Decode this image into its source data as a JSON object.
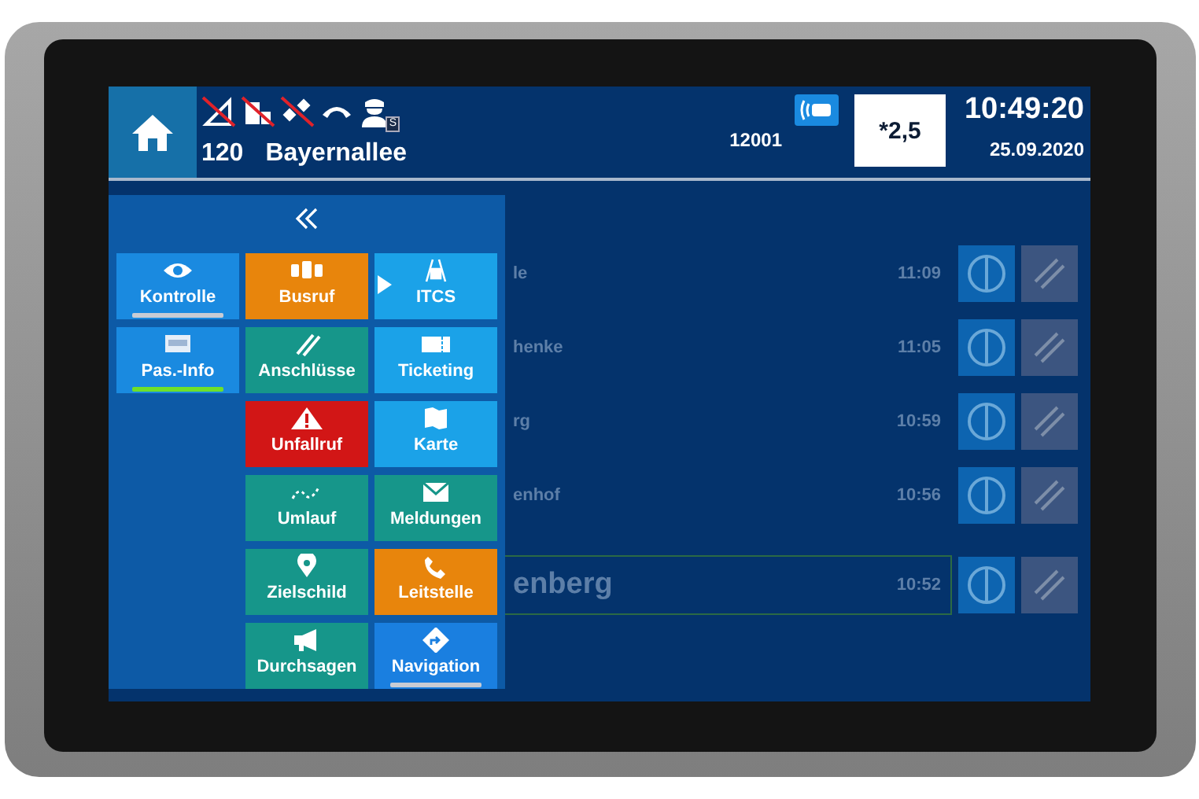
{
  "header": {
    "line": "120",
    "stop": "Bayernallee",
    "vehicle": "12001",
    "driver_badge": "S",
    "fare_zone": "*2,5",
    "time": "10:49:20",
    "date": "25.09.2020",
    "status_icons": [
      {
        "kind": "signal",
        "off": true
      },
      {
        "kind": "building",
        "off": true
      },
      {
        "kind": "satellite",
        "off": true
      },
      {
        "kind": "handset",
        "off": false
      }
    ]
  },
  "stops": [
    {
      "name": "le",
      "time": "11:09",
      "current": false
    },
    {
      "name": "henke",
      "time": "11:05",
      "current": false
    },
    {
      "name": "rg",
      "time": "10:59",
      "current": false
    },
    {
      "name": "enhof",
      "time": "10:56",
      "current": false
    },
    {
      "name": "enberg",
      "time": "10:52",
      "current": true
    }
  ],
  "menu": {
    "columns": [
      [
        {
          "label": "Kontrolle",
          "kind": "eye",
          "color": "#1a8ae0",
          "underline": {
            "color": "#c8ccd4"
          },
          "pointer": false
        },
        {
          "label": "Pas.-Info",
          "kind": "tft",
          "color": "#1a8ae0",
          "underline": {
            "color": "#6ee02a"
          },
          "pointer": false
        }
      ],
      [
        {
          "label": "Busruf",
          "kind": "buses",
          "color": "#e8850c",
          "pointer": false
        },
        {
          "label": "Anschlüsse",
          "kind": "connection",
          "color": "#16968a",
          "pointer": false
        },
        {
          "label": "Unfallruf",
          "kind": "warning",
          "color": "#d21616",
          "pointer": false
        },
        {
          "label": "Umlauf",
          "kind": "route",
          "color": "#16968a",
          "pointer": false
        },
        {
          "label": "Zielschild",
          "kind": "pin",
          "color": "#16968a",
          "pointer": false
        },
        {
          "label": "Durchsagen",
          "kind": "megaphone",
          "color": "#16968a",
          "pointer": false
        }
      ],
      [
        {
          "label": "ITCS",
          "kind": "road",
          "color": "#1ba2e8",
          "pointer": true
        },
        {
          "label": "Ticketing",
          "kind": "ticket",
          "color": "#1ba2e8",
          "pointer": false
        },
        {
          "label": "Karte",
          "kind": "map",
          "color": "#1ba2e8",
          "pointer": false
        },
        {
          "label": "Meldungen",
          "kind": "mail",
          "color": "#16968a",
          "pointer": false
        },
        {
          "label": "Leitstelle",
          "kind": "phone",
          "color": "#e8850c",
          "pointer": false
        },
        {
          "label": "Navigation",
          "kind": "navigation",
          "color": "#1a7fe0",
          "underline": {
            "color": "#c8ccd4"
          },
          "pointer": false
        }
      ]
    ]
  }
}
